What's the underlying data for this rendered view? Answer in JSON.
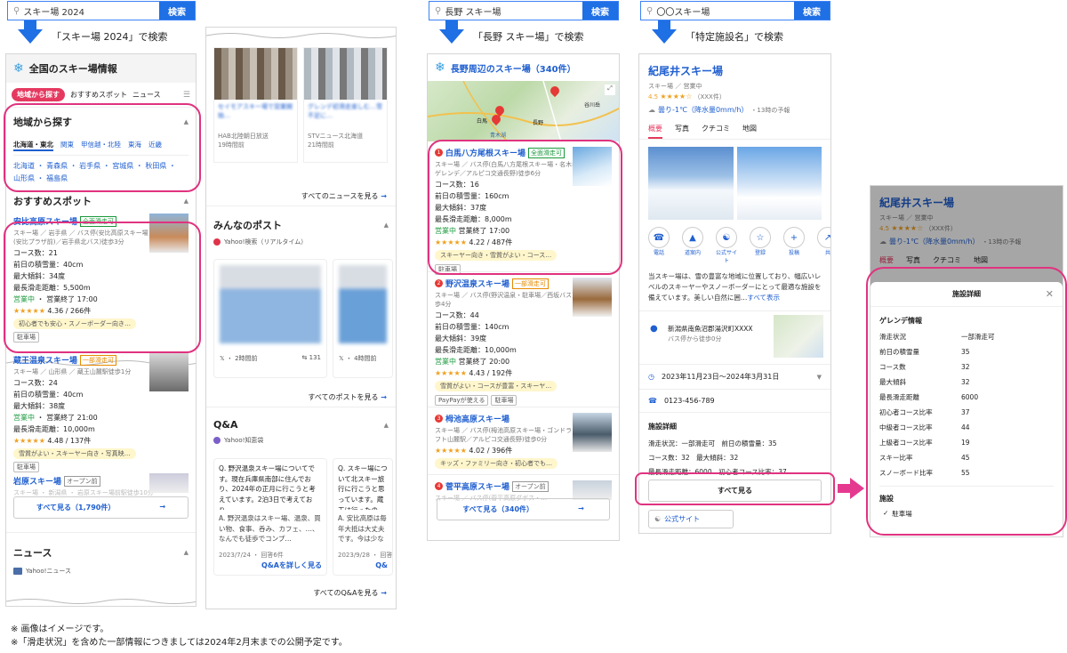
{
  "col1": {
    "search": {
      "query": "スキー場 2024",
      "button": "検索"
    },
    "flow_label": "「スキー場 2024」で検索",
    "title": "全国のスキー場情報",
    "tabs": [
      "地域から探す",
      "おすすめスポット",
      "ニュース"
    ],
    "region": {
      "heading": "地域から探す",
      "areas": [
        "北海道・東北",
        "関東",
        "甲信越・北陸",
        "東海",
        "近畿"
      ],
      "prefs_line1": "北海道 ・ 青森県 ・ 岩手県 ・ 宮城県 ・ 秋田県 ・",
      "prefs_line2": "山形県 ・ 福島県"
    },
    "recommend_heading": "おすすめスポット",
    "spot1": {
      "name": "安比高原スキー場",
      "badge": "全面滑走可",
      "sub1": "スキー場 ／ 岩手県 ／ バス停(安比高原スキー場",
      "sub2": "(安比プラザ前)／岩手県北バス)徒歩3分",
      "l1": "コース数：21",
      "l2": "前日の積雪量：40cm",
      "l3": "最大傾斜：34度",
      "l4": "最長滑走距離：5,500m",
      "open": "営業中",
      "close": "・ 営業終了 17:00",
      "rating": "4.36",
      "reviews": "266件",
      "tag": "初心者でも安心・スノーボーダー向き…",
      "chip": "駐車場"
    },
    "spot2": {
      "name": "蔵王温泉スキー場",
      "badge": "一部滑走可",
      "sub1": "スキー場 ／ 山形県 ／ 蔵王山麓駅徒歩1分",
      "l1": "コース数：24",
      "l2": "前日の積雪量：40cm",
      "l3": "最大傾斜：38度",
      "open": "営業中",
      "close": "・ 営業終了 21:00",
      "l4": "最長滑走距離：10,000m",
      "rating": "4.48",
      "reviews": "137件",
      "tag": "雪質がよい・スキーヤー向き・写真映…",
      "chip": "駐車場"
    },
    "spot3": {
      "name": "岩原スキー場",
      "badge": "オープン前",
      "sub1": "スキー場 ・ 新潟県 ・ 岩原スキー場前駅徒歩10分"
    },
    "see_all": "すべて見る（1,790件）",
    "news_heading": "ニュース",
    "news_source": "Yahoo!ニュース"
  },
  "col2": {
    "news1": {
      "title": "セイモアスキー場で営業開始…",
      "src": "HAB北陸朝日放送",
      "time": "19時間前"
    },
    "news2": {
      "title": "グレンデ初滑走楽しむ…雪不足に…",
      "src": "STVニュース北海道",
      "time": "21時間前"
    },
    "see_news": "すべてのニュースを見る",
    "posts_heading": "みんなのポスト",
    "posts_src": "Yahoo!検索（リアルタイム）",
    "post1": {
      "time": "2時間前",
      "rt": "131"
    },
    "post2": {
      "time": "4時間前"
    },
    "see_posts": "すべてのポストを見る",
    "qa_heading": "Q&A",
    "qa_src": "Yahoo!知恵袋",
    "qa1": {
      "q": "Q. 野沢温泉スキー場についてです。現在兵庫県南部に住んでおり、2024年の正月に行こうと考えています。2泊3日で考えており…",
      "a": "A. 野沢温泉はスキー場、温泉、買い物、食事、呑み、カフェ、…、なんでも徒歩でコンプ…",
      "date": "2023/7/24 ・ 回答6件",
      "more": "Q&Aを詳しく見る"
    },
    "qa2": {
      "q": "Q. スキー場について北スキー旅行に行こうと思っています。蔵王は行ったので、安比に興味があり…",
      "a": "A. 安比高原は毎年大抵は大丈夫です。今は少ない時もあります…",
      "date": "2023/9/28 ・ 回答6件",
      "more": "Q&"
    },
    "see_qa": "すべてのQ&Aを見る"
  },
  "col3": {
    "search": {
      "query": "長野 スキー場",
      "button": "検索"
    },
    "flow_label": "「長野 スキー場」で検索",
    "title": "長野周辺のスキー場（340件）",
    "map_labels": [
      "長野",
      "白馬",
      "谷川岳",
      "青木湖"
    ],
    "item1": {
      "num": "1",
      "name": "白馬八方尾根スキー場",
      "badge": "全面滑走可",
      "sub1": "スキー場 ／ バス停(白馬八方尾根スキー場・名木山",
      "sub2": "ゲレンデ／アルピコ交通長野)徒歩6分",
      "l1": "コース数：16",
      "l2": "前日の積雪量：160cm",
      "l3": "最大傾斜：37度",
      "l4": "最長滑走距離：8,000m",
      "open": "営業中",
      "close": "営業終了 17:00",
      "rating": "4.22",
      "reviews": "487件",
      "tag": "スキーヤー向き・雪質がよい・コース…",
      "chip": "駐車場"
    },
    "item2": {
      "num": "2",
      "name": "野沢温泉スキー場",
      "badge": "一部滑走可",
      "sub1": "スキー場 ／ バス停(野沢温泉・駐車場／西坂バス)徒",
      "sub2": "歩4分",
      "l1": "コース数：44",
      "l2": "前日の積雪量：140cm",
      "l3": "最大傾斜：39度",
      "l4": "最長滑走距離：10,000m",
      "open": "営業中",
      "close": "営業終了 20:00",
      "rating": "4.43",
      "reviews": "192件",
      "tag": "雪質がよい・コースが豊富・スキーヤ…",
      "chips": [
        "PayPayが使える",
        "駐車場"
      ]
    },
    "item3": {
      "num": "3",
      "name": "栂池高原スキー場",
      "sub1": "スキー場 ／ バス停(栂池高原スキー場・ゴンドラリ",
      "sub2": "フト山麓駅／アルピコ交通長野)徒歩0分",
      "rating": "4.02",
      "reviews": "396件",
      "tag": "キッズ・ファミリー向き・初心者でも…"
    },
    "item4": {
      "num": "4",
      "name": "菅平高原スキー場",
      "badge": "オープン前",
      "sub1": "スキー場 ／ バス停(菅平高原ダボス・…"
    },
    "see_all": "すべて見る（340件）"
  },
  "col4": {
    "search": {
      "query": "〇〇スキー場",
      "button": "検索"
    },
    "flow_label": "「特定施設名」で検索",
    "name": "紀尾井スキー場",
    "sub": "スキー場 ／ 営業中",
    "rating": "4.5",
    "reviews": "（XXX件）",
    "weather": "曇り-1℃（降水量0mm/h）",
    "weather_note": "・13時の予報",
    "tabs": [
      "概要",
      "写真",
      "クチコミ",
      "地図"
    ],
    "actions": [
      "電話",
      "道案内",
      "公式サイト",
      "登録",
      "投稿",
      "共"
    ],
    "desc": "当スキー場は、雪の豊富な地域に位置しており、幅広いレベルのスキーヤーやスノーボーダーにとって最適な施設を備えています。美しい自然に囲…",
    "desc_more": "すべて表示",
    "address": "新潟県南魚沼郡湯沢町XXXX",
    "address_sub": "バス停から徒歩0分",
    "period": "2023年11月23日〜2024年3月31日",
    "phone": "0123-456-789",
    "facility_heading": "施設詳細",
    "fd1": "滑走状況：一部滑走可　前日の積雪量：35",
    "fd2": "コース数：32　最大傾斜：32",
    "fd3": "最長滑走距離：6000　初心者コース比率：37…",
    "see_all": "すべて見る",
    "official": "公式サイト"
  },
  "col5": {
    "name": "紀尾井スキー場",
    "sub": "スキー場 ／ 営業中",
    "rating": "4.5",
    "reviews": "（XXX件）",
    "weather": "曇り-1℃（降水量0mm/h）",
    "weather_note": "・13時の予報",
    "tabs": [
      "概要",
      "写真",
      "クチコミ",
      "地図"
    ],
    "modal_title": "施設詳細",
    "gelande_heading": "ゲレンデ情報",
    "rows": [
      [
        "滑走状況",
        "一部滑走可"
      ],
      [
        "前日の積雪量",
        "35"
      ],
      [
        "コース数",
        "32"
      ],
      [
        "最大傾斜",
        "32"
      ],
      [
        "最長滑走距離",
        "6000"
      ],
      [
        "初心者コース比率",
        "37"
      ],
      [
        "中級者コース比率",
        "44"
      ],
      [
        "上級者コース比率",
        "19"
      ],
      [
        "スキー比率",
        "45"
      ],
      [
        "スノーボード比率",
        "55"
      ]
    ],
    "facility_heading": "施設",
    "facility_item": "駐車場"
  },
  "footnote1": "※ 画像はイメージです。",
  "footnote2": "※「滑走状況」を含めた一部情報につきましては2024年2月末までの公開予定です。"
}
